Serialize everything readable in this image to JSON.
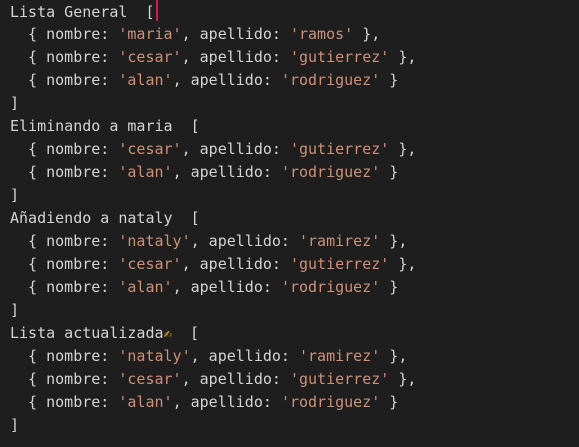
{
  "console": {
    "blocks": [
      {
        "title": "Lista General",
        "open": "[",
        "close": "]",
        "rows": [
          {
            "pre": "  { nombre: ",
            "nombre": "'maria'",
            "mid": ", apellido: ",
            "apellido": "'ramos'",
            "post": " },"
          },
          {
            "pre": "  { nombre: ",
            "nombre": "'cesar'",
            "mid": ", apellido: ",
            "apellido": "'gutierrez'",
            "post": " },"
          },
          {
            "pre": "  { nombre: ",
            "nombre": "'alan'",
            "mid": ", apellido: ",
            "apellido": "'rodriguez'",
            "post": " }"
          }
        ]
      },
      {
        "title": "Eliminando a maria",
        "open": "[",
        "close": "]",
        "rows": [
          {
            "pre": "  { nombre: ",
            "nombre": "'cesar'",
            "mid": ", apellido: ",
            "apellido": "'gutierrez'",
            "post": " },"
          },
          {
            "pre": "  { nombre: ",
            "nombre": "'alan'",
            "mid": ", apellido: ",
            "apellido": "'rodriguez'",
            "post": " }"
          }
        ]
      },
      {
        "title": "Añadiendo a nataly",
        "open": "[",
        "close": "]",
        "rows": [
          {
            "pre": "  { nombre: ",
            "nombre": "'nataly'",
            "mid": ", apellido: ",
            "apellido": "'ramirez'",
            "post": " },"
          },
          {
            "pre": "  { nombre: ",
            "nombre": "'cesar'",
            "mid": ", apellido: ",
            "apellido": "'gutierrez'",
            "post": " },"
          },
          {
            "pre": "  { nombre: ",
            "nombre": "'alan'",
            "mid": ", apellido: ",
            "apellido": "'rodriguez'",
            "post": " }"
          }
        ]
      },
      {
        "title": "Lista actualizada",
        "emoji": "✍",
        "open": "[",
        "close": "]",
        "rows": [
          {
            "pre": "  { nombre: ",
            "nombre": "'nataly'",
            "mid": ", apellido: ",
            "apellido": "'ramirez'",
            "post": " },"
          },
          {
            "pre": "  { nombre: ",
            "nombre": "'cesar'",
            "mid": ", apellido: ",
            "apellido": "'gutierrez'",
            "post": " },"
          },
          {
            "pre": "  { nombre: ",
            "nombre": "'alan'",
            "mid": ", apellido: ",
            "apellido": "'rodriguez'",
            "post": " }"
          }
        ]
      }
    ]
  }
}
